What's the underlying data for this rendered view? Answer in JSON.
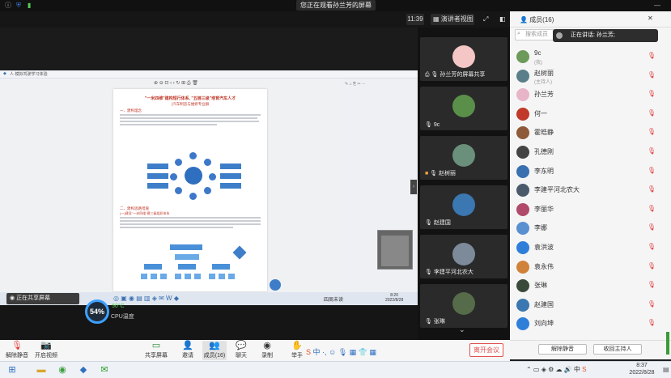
{
  "topbar": {
    "banner": "您正在观看孙兰芳的屏幕",
    "time": "11:39",
    "view_mode": "演讲者视图",
    "members_title": "成员(16)"
  },
  "share_window": {
    "title": "人·模拟驾驶学习体验",
    "doc_title": "\"一米四维\"建构短行体系, \"五链三级\"培育汽车人才",
    "doc_subtitle": "(汽车制造与维修专业群",
    "section1": "一、建构理念",
    "section2": "二、建构思路措施",
    "section2_sub": "(一)建设\"一米四维\"建三级组织体系",
    "cpu_percent": "54%",
    "cpu_temp": "50°C",
    "cpu_label": "CPU温度",
    "caption": "正在共享屏幕",
    "inner_clock_time": "8:20",
    "inner_clock_date": "2022/8/28",
    "inner_taskbar_text": "四周未读"
  },
  "gallery": [
    {
      "label": "孙兰芳的屏幕共享",
      "color": "#f4c6c6"
    },
    {
      "label": "9c",
      "color": "#5a8f4a"
    },
    {
      "label": "赵树丽",
      "color": "#6a8f7a"
    },
    {
      "label": "赵建国",
      "color": "#3b77b0"
    },
    {
      "label": "李建平河北农大",
      "color": "#7c8a99"
    },
    {
      "label": "张琳",
      "color": "#556b4a"
    }
  ],
  "panel": {
    "search_placeholder": "搜索成员",
    "speaking": "正在讲话: 孙兰芳;",
    "participants": [
      {
        "name": "9c",
        "sub": "(我)",
        "color": "#6c9a5a"
      },
      {
        "name": "赵树丽",
        "sub": "(主持人)",
        "color": "#5a7f8a"
      },
      {
        "name": "孙兰芳",
        "sub": "",
        "color": "#e8b4c8"
      },
      {
        "name": "何一",
        "sub": "",
        "color": "#c0392b"
      },
      {
        "name": "霍皓静",
        "sub": "",
        "color": "#8e5a3a"
      },
      {
        "name": "孔德刚",
        "sub": "",
        "color": "#444"
      },
      {
        "name": "李东明",
        "sub": "",
        "color": "#3a6fb0"
      },
      {
        "name": "李建平河北农大",
        "sub": "",
        "color": "#4a5a6a"
      },
      {
        "name": "李丽华",
        "sub": "",
        "color": "#b04a6a"
      },
      {
        "name": "李娜",
        "sub": "",
        "color": "#5a8fd0"
      },
      {
        "name": "袁洪波",
        "sub": "",
        "color": "#2f7fd9"
      },
      {
        "name": "袁永伟",
        "sub": "",
        "color": "#d0823a"
      },
      {
        "name": "张琳",
        "sub": "",
        "color": "#3a4a3a"
      },
      {
        "name": "赵建国",
        "sub": "",
        "color": "#3b77b0"
      },
      {
        "name": "刘向坤",
        "sub": "",
        "color": "#2f7fd9"
      }
    ],
    "unmute_all": "解除静音",
    "take_host": "收回主持人"
  },
  "meetbar": {
    "mute": "解除静音",
    "video": "开启视频",
    "share": "共享屏幕",
    "invite": "邀请",
    "members": "成员(16)",
    "chat": "聊天",
    "record": "录制",
    "raise_hand": "举手",
    "leave": "离开会议"
  },
  "clock": {
    "time": "8:37",
    "date": "2022/8/28"
  }
}
